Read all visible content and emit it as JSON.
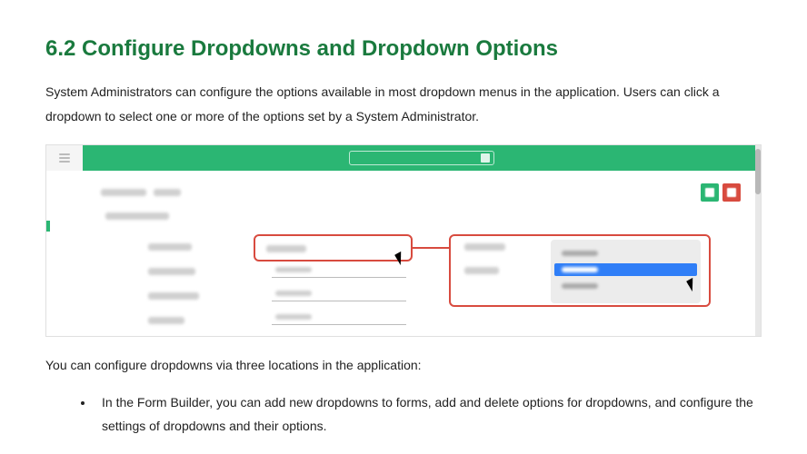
{
  "section": {
    "heading": "6.2 Configure Dropdowns and Dropdown Options",
    "intro": "System Administrators can configure the options available in most dropdown menus in the application. Users can click a dropdown to select one or more of the options set by a System Administrator.",
    "list_intro": "You can configure dropdowns via three locations in the application:",
    "bullets": [
      "In the Form Builder, you can add new dropdowns to forms, add and delete options for dropdowns, and configure the settings of dropdowns and their options."
    ]
  }
}
